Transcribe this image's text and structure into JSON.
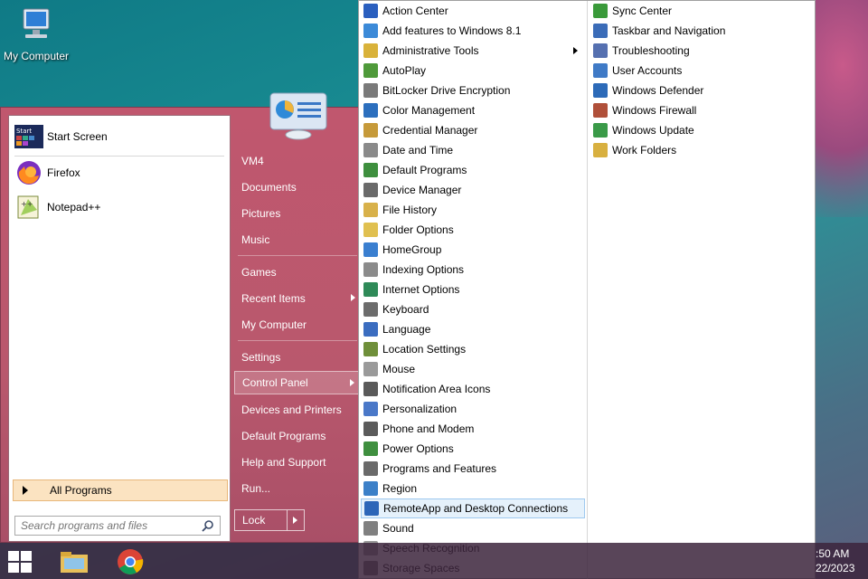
{
  "desktop": {
    "icon_label": "My Computer"
  },
  "start_menu": {
    "pinned": [
      {
        "label": "Start Screen",
        "icon": "start-screen-icon"
      },
      {
        "label": "Firefox",
        "icon": "firefox-icon"
      },
      {
        "label": "Notepad++",
        "icon": "notepadpp-icon"
      }
    ],
    "all_programs": "All Programs",
    "search_placeholder": "Search programs and files",
    "right_items": [
      {
        "label": "VM4"
      },
      {
        "label": "Documents"
      },
      {
        "label": "Pictures"
      },
      {
        "label": "Music"
      },
      {
        "label": "Games"
      },
      {
        "label": "Recent Items"
      },
      {
        "label": "My Computer"
      },
      {
        "label": "Settings"
      },
      {
        "label": "Control Panel"
      },
      {
        "label": "Devices and Printers"
      },
      {
        "label": "Default Programs"
      },
      {
        "label": "Help and Support"
      },
      {
        "label": "Run..."
      }
    ],
    "lock_label": "Lock"
  },
  "control_panel": {
    "col1": [
      {
        "label": "Action Center",
        "color": "#2a5fbf"
      },
      {
        "label": "Add features to Windows 8.1",
        "color": "#3c8ad8"
      },
      {
        "label": "Administrative Tools",
        "color": "#d9b23a"
      },
      {
        "label": "AutoPlay",
        "color": "#4f9a3a"
      },
      {
        "label": "BitLocker Drive Encryption",
        "color": "#7a7a7a"
      },
      {
        "label": "Color Management",
        "color": "#2c6fbe"
      },
      {
        "label": "Credential Manager",
        "color": "#c69a3a"
      },
      {
        "label": "Date and Time",
        "color": "#8a8a8a"
      },
      {
        "label": "Default Programs",
        "color": "#3e8f3e"
      },
      {
        "label": "Device Manager",
        "color": "#6a6a6a"
      },
      {
        "label": "File History",
        "color": "#d8b14a"
      },
      {
        "label": "Folder Options",
        "color": "#e0c050"
      },
      {
        "label": "HomeGroup",
        "color": "#3a7fd0"
      },
      {
        "label": "Indexing Options",
        "color": "#8b8b8b"
      },
      {
        "label": "Internet Options",
        "color": "#2f8a58"
      },
      {
        "label": "Keyboard",
        "color": "#6c6c6c"
      },
      {
        "label": "Language",
        "color": "#3b6dc0"
      },
      {
        "label": "Location Settings",
        "color": "#6f8f3a"
      },
      {
        "label": "Mouse",
        "color": "#9a9a9a"
      },
      {
        "label": "Notification Area Icons",
        "color": "#5a5a5a"
      },
      {
        "label": "Personalization",
        "color": "#4a78c8"
      },
      {
        "label": "Phone and Modem",
        "color": "#5b5b5b"
      },
      {
        "label": "Power Options",
        "color": "#3f8f3f"
      },
      {
        "label": "Programs and Features",
        "color": "#6a6a6a"
      },
      {
        "label": "Region",
        "color": "#3c80c8"
      },
      {
        "label": "RemoteApp and Desktop Connections",
        "color": "#2d66b8"
      },
      {
        "label": "Sound",
        "color": "#808080"
      },
      {
        "label": "Speech Recognition",
        "color": "#9a9a9a"
      },
      {
        "label": "Storage Spaces",
        "color": "#707070"
      }
    ],
    "col2": [
      {
        "label": "Sync Center",
        "color": "#3a9a3a"
      },
      {
        "label": "Taskbar and Navigation",
        "color": "#3b6cb8"
      },
      {
        "label": "Troubleshooting",
        "color": "#5570b0"
      },
      {
        "label": "User Accounts",
        "color": "#3f7ac6"
      },
      {
        "label": "Windows Defender",
        "color": "#2c6ab8"
      },
      {
        "label": "Windows Firewall",
        "color": "#b0503a"
      },
      {
        "label": "Windows Update",
        "color": "#3a9a48"
      },
      {
        "label": "Work Folders",
        "color": "#d8b040"
      }
    ]
  },
  "taskbar": {
    "clock_time": ":50 AM",
    "clock_date": "22/2023"
  }
}
